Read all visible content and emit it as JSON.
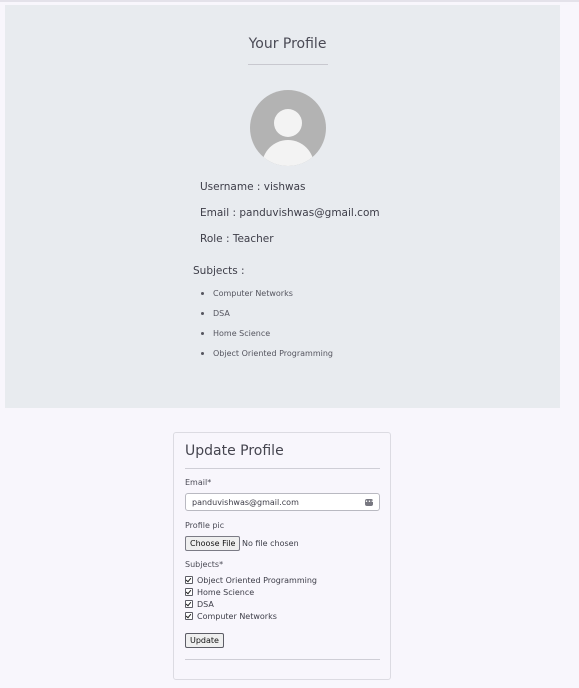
{
  "profile": {
    "title": "Your Profile",
    "username_line": "Username : vishwas",
    "email_line": "Email : panduvishwas@gmail.com",
    "role_line": "Role : Teacher",
    "subjects_heading": "Subjects :",
    "subjects": [
      "Computer Networks",
      "DSA",
      "Home Science",
      "Object Oriented Programming"
    ]
  },
  "update_form": {
    "title": "Update Profile",
    "email_label": "Email*",
    "email_value": "panduvishwas@gmail.com",
    "profile_pic_label": "Profile pic",
    "choose_file_label": "Choose File",
    "file_status": "No file chosen",
    "subjects_label": "Subjects*",
    "subject_options": [
      {
        "label": "Object Oriented Programming",
        "checked": true
      },
      {
        "label": "Home Science",
        "checked": true
      },
      {
        "label": "DSA",
        "checked": true
      },
      {
        "label": "Computer Networks",
        "checked": true
      }
    ],
    "update_button": "Update"
  },
  "colors": {
    "page_bg": "#f8f6fc",
    "profile_card_bg": "#e8ebef",
    "avatar_bg": "#b3b3b3"
  }
}
